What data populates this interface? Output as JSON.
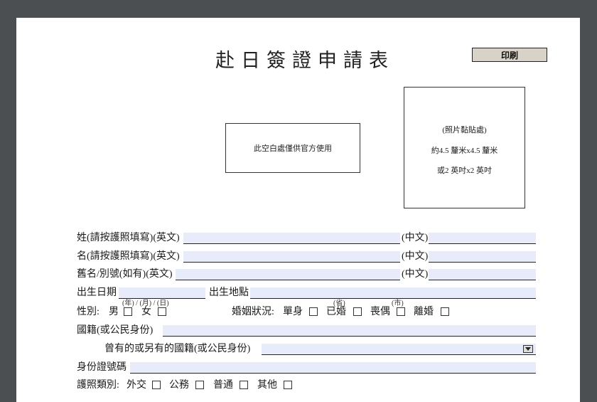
{
  "form": {
    "title": "赴日簽證申請表",
    "print_button": "印刷",
    "official_use": "此空白處僅供官方使用",
    "photo": {
      "line1": "(照片黏貼處)",
      "line2": "約4.5 釐米x4.5 釐米",
      "line3": "或2 英吋x2 英吋"
    },
    "surname_en_label": "姓(請按護照填寫)(英文)",
    "given_en_label": "名(請按護照填寫)(英文)",
    "former_en_label": "舊名/別號(如有)(英文)",
    "chinese_label": "(中文)",
    "dob_label": "出生日期",
    "dob_hint": "(年) / (月) / (日)",
    "pob_label": "出生地點",
    "province_hint": "(省)",
    "city_hint": "(市)",
    "sex_label": "性別:",
    "male": "男",
    "female": "女",
    "marital_label": "婚姻狀況:",
    "single": "單身",
    "married": "已婚",
    "widowed": "喪偶",
    "divorced": "離婚",
    "nationality_label": "國籍(或公民身份)",
    "former_nationality_label": "曾有的或另有的國籍(或公民身份)",
    "id_label": "身份證號碼",
    "passport_type_label": "護照類別:",
    "diplomatic": "外交",
    "official": "公務",
    "ordinary": "普通",
    "other": "其他"
  },
  "colors": {
    "background": "#4b4f52",
    "page": "#ffffff",
    "field_fill": "#e8ebfa",
    "button_fill": "#d8d2c8"
  }
}
